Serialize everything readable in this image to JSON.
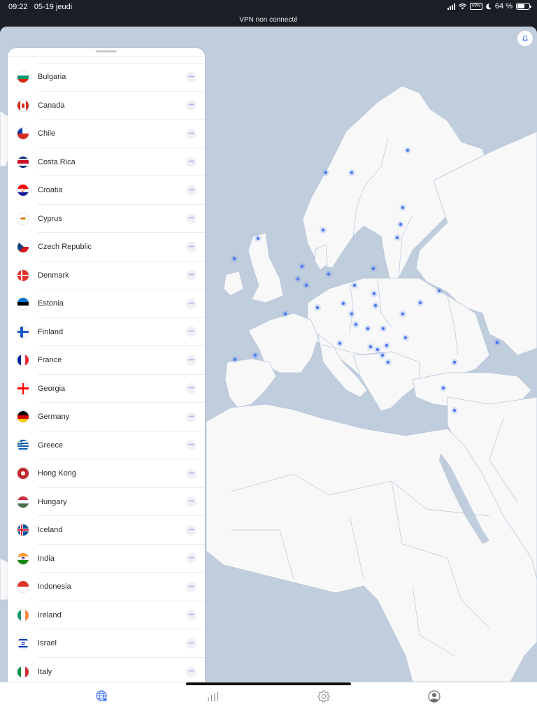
{
  "status_bar": {
    "time": "09:22",
    "date": "05-19 jeudi",
    "vpn_badge": "VPN",
    "battery": "64 %",
    "battery_level": 0.64,
    "vpn_status": "VPN non connecté"
  },
  "map": {
    "bell_icon": "bell-icon",
    "server_marker_color": "#4a7af0",
    "land_color": "#f8f8f9",
    "sea_color": "#c0cddd"
  },
  "countries": [
    {
      "name": "Bulgaria",
      "flag": "bulgaria"
    },
    {
      "name": "Canada",
      "flag": "canada"
    },
    {
      "name": "Chile",
      "flag": "chile"
    },
    {
      "name": "Costa Rica",
      "flag": "costa-rica"
    },
    {
      "name": "Croatia",
      "flag": "croatia"
    },
    {
      "name": "Cyprus",
      "flag": "cyprus"
    },
    {
      "name": "Czech Republic",
      "flag": "czech-republic"
    },
    {
      "name": "Denmark",
      "flag": "denmark"
    },
    {
      "name": "Estonia",
      "flag": "estonia"
    },
    {
      "name": "Finland",
      "flag": "finland"
    },
    {
      "name": "France",
      "flag": "france"
    },
    {
      "name": "Georgia",
      "flag": "georgia"
    },
    {
      "name": "Germany",
      "flag": "germany"
    },
    {
      "name": "Greece",
      "flag": "greece"
    },
    {
      "name": "Hong Kong",
      "flag": "hong-kong"
    },
    {
      "name": "Hungary",
      "flag": "hungary"
    },
    {
      "name": "Iceland",
      "flag": "iceland"
    },
    {
      "name": "India",
      "flag": "india"
    },
    {
      "name": "Indonesia",
      "flag": "indonesia"
    },
    {
      "name": "Ireland",
      "flag": "ireland"
    },
    {
      "name": "Israel",
      "flag": "israel"
    },
    {
      "name": "Italy",
      "flag": "italy"
    }
  ],
  "more_label": "•••",
  "tabbar": {
    "tabs": [
      {
        "name": "globe-lock-icon",
        "active": true
      },
      {
        "name": "stats-bars-icon",
        "active": false
      },
      {
        "name": "gear-icon",
        "active": false
      },
      {
        "name": "profile-icon",
        "active": false
      }
    ],
    "active_color": "#4a7af0",
    "inactive_color": "#8e8e93"
  }
}
